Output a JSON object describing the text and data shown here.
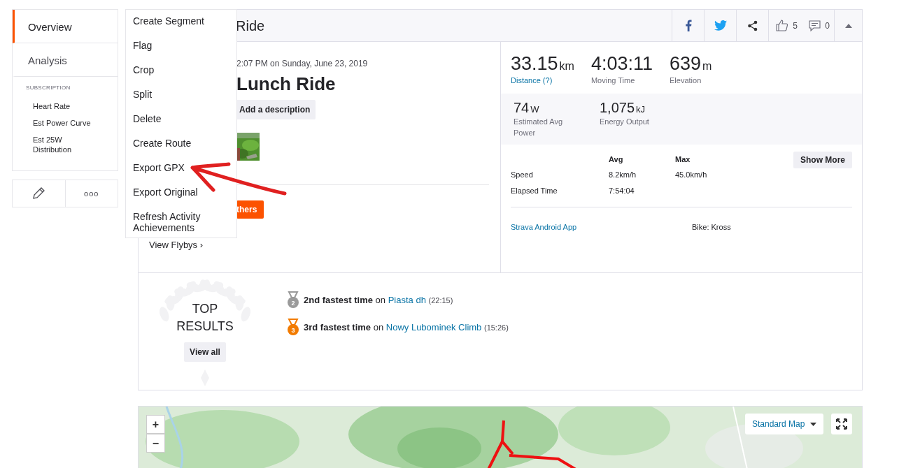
{
  "sidebar": {
    "items": [
      {
        "label": "Overview",
        "selected": true
      },
      {
        "label": "Analysis",
        "selected": false
      }
    ],
    "section_title": "SUBSCRIPTION",
    "sub_items": [
      "Heart Rate",
      "Est Power Curve",
      "Est 25W Distribution"
    ]
  },
  "actions": {
    "more_label": "ooo"
  },
  "menu": {
    "items": [
      "Create Segment",
      "Flag",
      "Crop",
      "Split",
      "Delete",
      "Create Route",
      "Export GPX",
      "Export Original",
      "Refresh Activity Achievements"
    ]
  },
  "activity": {
    "header_title": "Ride",
    "kudos": "5",
    "comments": "0",
    "date": "2:07 PM on Sunday, June 23, 2019",
    "title": "Lunch Ride",
    "description_button": "Add a description",
    "others_button": "thers",
    "flybys": "View Flybys",
    "flybys_chevron": "›"
  },
  "stats": [
    {
      "value": "33.15",
      "unit": "km",
      "label": "Distance (?)",
      "kind": "link"
    },
    {
      "value": "4:03:11",
      "label": "Moving Time",
      "kind": "plain"
    },
    {
      "value": "639",
      "unit": "m",
      "label": "Elevation",
      "kind": "plain"
    }
  ],
  "secondary_stats": [
    {
      "value": "74",
      "unit": "W",
      "label": "Estimated Avg Power"
    },
    {
      "value": "1,075",
      "unit": "kJ",
      "label": "Energy Output"
    }
  ],
  "table": {
    "columns": [
      "Avg",
      "Max"
    ],
    "rows": [
      {
        "label": "Speed",
        "cells": [
          "8.2km/h",
          "45.0km/h"
        ]
      },
      {
        "label": "Elapsed Time",
        "cells": [
          "7:54:04",
          ""
        ]
      }
    ],
    "button": "Show More"
  },
  "device": "Strava Android App",
  "bike": "Bike: Kross",
  "top_results": {
    "title": "TOP RESULTS",
    "button": "View all",
    "results": [
      {
        "medal": "2",
        "color": "#9a9a9a",
        "achievement": "2nd fastest time",
        "connector": "on",
        "segment": "Piasta dh",
        "time": "(22:15)"
      },
      {
        "medal": "3",
        "color": "#f27b00",
        "achievement": "3rd fastest time",
        "connector": "on",
        "segment": "Nowy Lubominek Climb",
        "time": "(15:26)"
      }
    ]
  },
  "map": {
    "zoom_in": "+",
    "zoom_out": "−",
    "map_type": "Standard Map"
  }
}
